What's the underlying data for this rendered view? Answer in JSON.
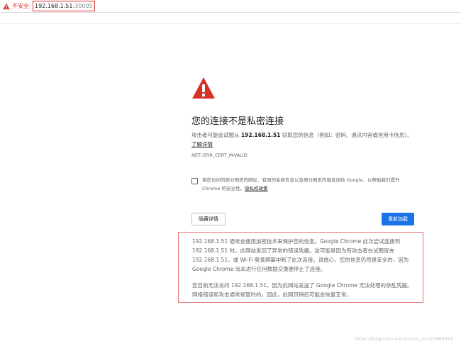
{
  "address_bar": {
    "security_label": "不安全",
    "url_host": "192.168.1.51",
    "url_port": ":30005"
  },
  "interstitial": {
    "heading": "您的连接不是私密连接",
    "explanation_before": "攻击者可能会试图从 ",
    "explanation_host": "192.168.1.51",
    "explanation_after": " 窃取您的信息（例如：密码、通讯内容或信用卡信息）。",
    "learn_more_link": "了解详情",
    "error_code": "NET::ERR_CERT_INVALID",
    "optin_text": "将您访问的部分网页的网址、有限的系统信息以及部分网页内容发送给 Google，以帮助我们提升 Chrome 的安全性。",
    "privacy_link": "隐私权政策",
    "details_button": "隐藏详情",
    "reload_button": "重新加载",
    "details_paragraph_1": "192.168.1.51 通常会使用加密技术来保护您的信息。Google Chrome 此次尝试连接到 192.168.1.51 时，此网站发回了异常的错误凭据。这可能是因为有攻击者在试图冒充 192.168.1.51，或 Wi-Fi 登录屏幕中断了此次连接。请放心，您的信息仍然是安全的，因为 Google Chrome 尚未进行任何数据交换便停止了连接。",
    "details_paragraph_2": "您目前无法访问 192.168.1.51，因为此网站发送了 Google Chrome 无法处理的杂乱凭据。网络错误和攻击通常是暂时的，因此，此网页稍后可能会恢复正常。"
  },
  "watermark": "https://blog.csdn.net/weixin_42187869663",
  "colors": {
    "warning_red": "#d93025",
    "primary_blue": "#1a73e8",
    "highlight_border": "#e57373"
  }
}
